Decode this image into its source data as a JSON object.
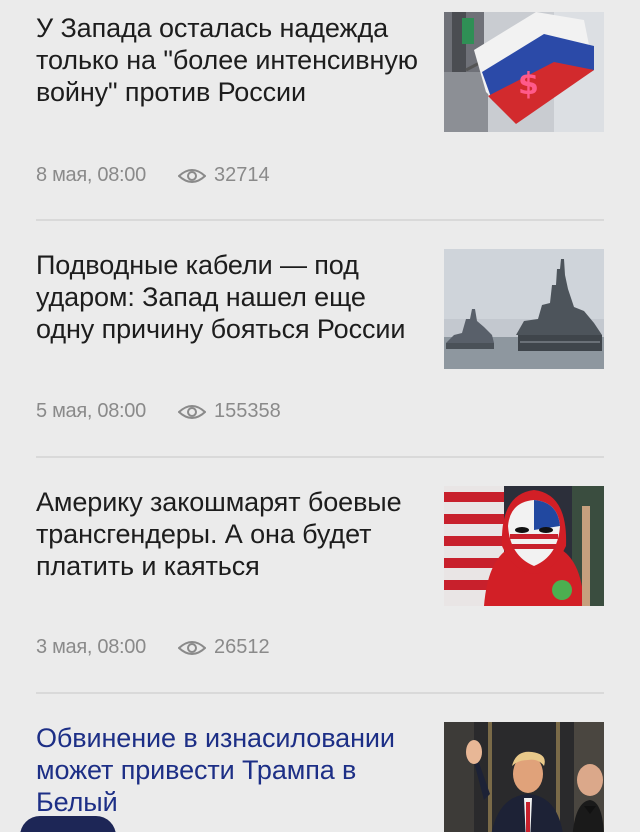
{
  "articles": [
    {
      "title": "У Запада осталась надежда только на \"более интенсивную войну\" против России",
      "date": "8 мая, 08:00",
      "views": "32714",
      "image": "russian-flag-dollar-photo"
    },
    {
      "title": "Подводные кабели — под ударом: Запад нашел еще одну причину бояться России",
      "date": "5 мая, 08:00",
      "views": "155358",
      "image": "warships-photo"
    },
    {
      "title": "Америку закошмарят боевые трансгендеры. А она будет платить и каяться",
      "date": "3 мая, 08:00",
      "views": "26512",
      "image": "masked-protester-photo"
    },
    {
      "title": "Обвинение в изнасиловании может привести Трампа в Белый",
      "image": "trump-waving-photo"
    }
  ],
  "icons": {
    "views": "eye-icon"
  },
  "colors": {
    "title": "#1d1d1d",
    "highlight_title": "#1d2f86",
    "meta": "#8a8a8a",
    "background": "#ebebeb"
  }
}
